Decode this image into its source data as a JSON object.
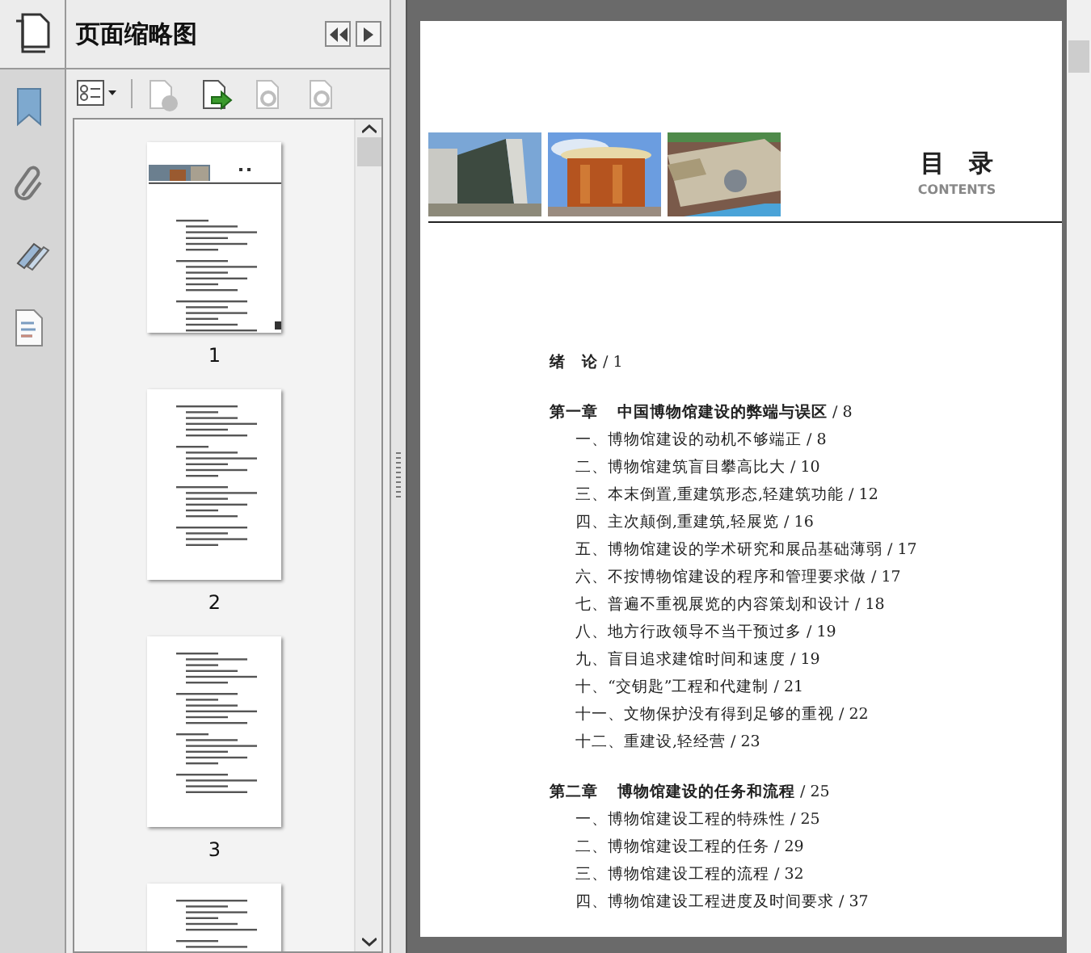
{
  "panel": {
    "title": "页面缩略图"
  },
  "toolbar_buttons": [
    {
      "kind": "options",
      "disabled": false
    },
    {
      "kind": "delete",
      "disabled": true
    },
    {
      "kind": "extract",
      "disabled": false
    },
    {
      "kind": "undo",
      "disabled": true
    },
    {
      "kind": "redo",
      "disabled": true
    }
  ],
  "thumbnails": [
    {
      "kind": "cover",
      "label": "1"
    },
    {
      "kind": "list",
      "label": "2"
    },
    {
      "kind": "list",
      "label": "3"
    },
    {
      "kind": "cut"
    }
  ],
  "document": {
    "heading": "目　录",
    "subheading": "CONTENTS",
    "entries": [
      {
        "kind": "intro",
        "text": "**绪　论** / 1"
      },
      {
        "kind": "chapter",
        "number": "第一章",
        "text": "**中国博物馆建设的弊端与误区** / 8"
      },
      {
        "kind": "section",
        "text": "一、博物馆建设的动机不够端正 / 8"
      },
      {
        "kind": "section",
        "text": "二、博物馆建筑盲目攀高比大 / 10"
      },
      {
        "kind": "section",
        "text": "三、本末倒置,重建筑形态,轻建筑功能 / 12"
      },
      {
        "kind": "section",
        "text": "四、主次颠倒,重建筑,轻展览 / 16"
      },
      {
        "kind": "section",
        "text": "五、博物馆建设的学术研究和展品基础薄弱 / 17"
      },
      {
        "kind": "section",
        "text": "六、不按博物馆建设的程序和管理要求做 / 17"
      },
      {
        "kind": "section",
        "text": "七、普遍不重视展览的内容策划和设计 / 18"
      },
      {
        "kind": "section",
        "text": "八、地方行政领导不当干预过多 / 19"
      },
      {
        "kind": "section",
        "text": "九、盲目追求建馆时间和速度 / 19"
      },
      {
        "kind": "section",
        "text": "十、“交钥匙”工程和代建制 / 21"
      },
      {
        "kind": "section",
        "text": "十一、文物保护没有得到足够的重视 / 22"
      },
      {
        "kind": "section",
        "text": "十二、重建设,轻经营 / 23"
      },
      {
        "kind": "chapter",
        "number": "第二章",
        "text": "**博物馆建设的任务和流程** / 25"
      },
      {
        "kind": "section",
        "text": "一、博物馆建设工程的特殊性 / 25"
      },
      {
        "kind": "section",
        "text": "二、博物馆建设工程的任务 / 29"
      },
      {
        "kind": "section",
        "text": "三、博物馆建设工程的流程 / 32"
      },
      {
        "kind": "section",
        "text": "四、博物馆建设工程进度及时间要求 / 37"
      }
    ]
  }
}
